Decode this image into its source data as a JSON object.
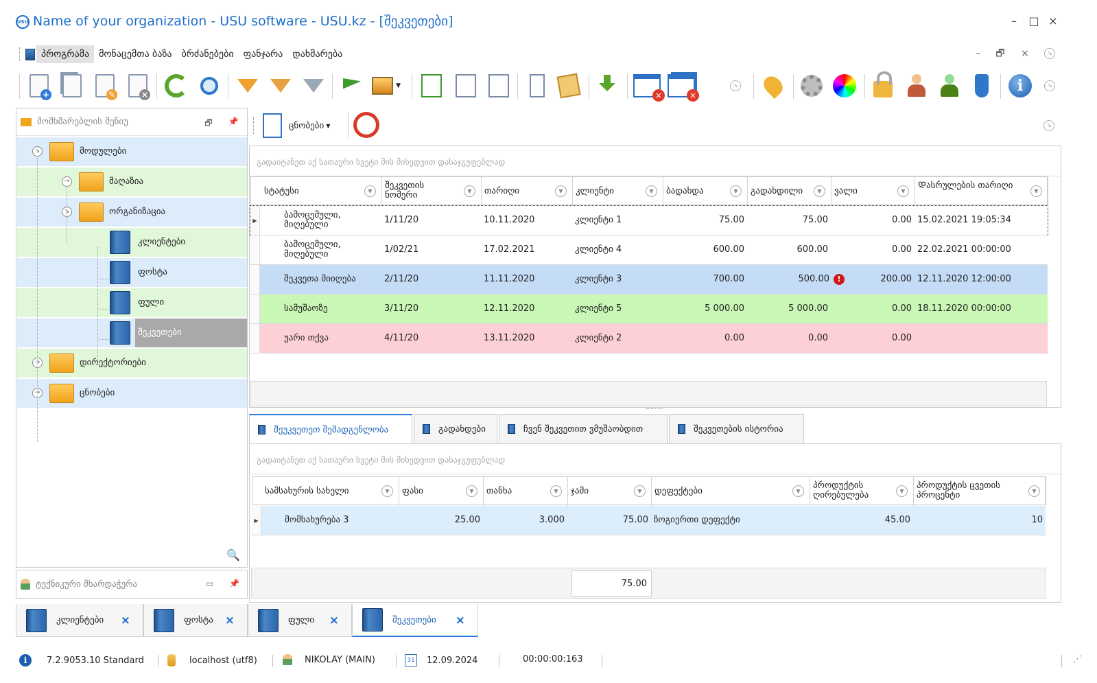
{
  "window": {
    "logo_text": "USU",
    "title": "Name of your organization - USU software - USU.kz - [შეკვეთები]",
    "minimize": "–",
    "maximize": "□",
    "close": "×"
  },
  "menu": {
    "items": [
      "პროგრამა",
      "მონაცემთა ბაზა",
      "ბრძანებები",
      "ფანჯარა",
      "დახმარება"
    ],
    "active_index": 0
  },
  "toolbar": {
    "icons": [
      "add-icon",
      "copy-icon",
      "edit-icon",
      "delete-icon",
      "refresh-icon",
      "search-icon",
      "filter-icon",
      "filter-settings-icon",
      "filter-clear-icon",
      "flag-icon",
      "image-icon",
      "expand-all-icon",
      "tree-collapse-icon",
      "tree-expand-icon",
      "add-column-icon",
      "notes-icon",
      "download-icon",
      "close-window-icon",
      "close-all-windows-icon",
      "location-pin-icon",
      "settings-gear-icon",
      "color-wheel-icon",
      "lock-icon",
      "user-keys-icon",
      "users-icon",
      "plug-icon",
      "info-icon"
    ]
  },
  "left_panel": {
    "title": "მომხმარებლის მენიუ",
    "tree": [
      {
        "label": "მოდულები",
        "level": 0,
        "expanded": true,
        "type": "folder"
      },
      {
        "label": "მაღაზია",
        "level": 1,
        "expanded": false,
        "type": "folder"
      },
      {
        "label": "ორგანიზაცია",
        "level": 1,
        "expanded": true,
        "type": "folder"
      },
      {
        "label": "კლიენტები",
        "level": 2,
        "type": "book"
      },
      {
        "label": "ფოსტა",
        "level": 2,
        "type": "book"
      },
      {
        "label": "ფული",
        "level": 2,
        "type": "book"
      },
      {
        "label": "შეკვეთები",
        "level": 2,
        "type": "book",
        "selected": true
      },
      {
        "label": "დირექტორიები",
        "level": 0,
        "expanded": false,
        "type": "folder"
      },
      {
        "label": "ცნობები",
        "level": 0,
        "expanded": false,
        "type": "folder"
      }
    ],
    "search_icon": "search-icon"
  },
  "support_panel": {
    "title": "ტექნიკური მხარდაჭერა"
  },
  "reports_toolbar": {
    "reports_label": "ცნობები"
  },
  "orders_grid": {
    "group_hint": "გადაიტანეთ აქ სათაური სვეტი მის მიხედვით დასაჯგუფებლად",
    "columns": [
      "სტატუსი",
      "შეკვეთის ნომერი",
      "თარიღი",
      "კლიენტი",
      "ბადახდა",
      "გადახდილი",
      "ვალი",
      "Დასრულების თარიღი"
    ],
    "rows": [
      {
        "status": "ბამოცემული, მიღებული",
        "number": "1/11/20",
        "date": "10.11.2020",
        "client": "კლიენტი 1",
        "paid_due": "75.00",
        "paid": "75.00",
        "debt": "0.00",
        "completed": "15.02.2021 19:05:34",
        "color": "#ffffff",
        "alert": false,
        "current": true
      },
      {
        "status": "ბამოცემული, მიღებული",
        "number": "1/02/21",
        "date": "17.02.2021",
        "client": "კლიენტი 4",
        "paid_due": "600.00",
        "paid": "600.00",
        "debt": "0.00",
        "completed": "22.02.2021 00:00:00",
        "color": "#ffffff",
        "alert": false,
        "current": false
      },
      {
        "status": "შეკვეთა მიიღება",
        "number": "2/11/20",
        "date": "11.11.2020",
        "client": "კლიენტი 3",
        "paid_due": "700.00",
        "paid": "500.00",
        "debt": "200.00",
        "completed": "12.11.2020 12:00:00",
        "color": "#c5dcf6",
        "alert": true,
        "current": false
      },
      {
        "status": "სამუშაოზე",
        "number": "3/11/20",
        "date": "12.11.2020",
        "client": "კლიენტი 5",
        "paid_due": "5 000.00",
        "paid": "5 000.00",
        "debt": "0.00",
        "completed": "18.11.2020 00:00:00",
        "color": "#c9f7b5",
        "alert": false,
        "current": false
      },
      {
        "status": "უარი თქვა",
        "number": "4/11/20",
        "date": "13.11.2020",
        "client": "კლიენტი 2",
        "paid_due": "0.00",
        "paid": "0.00",
        "debt": "0.00",
        "completed": "",
        "color": "#fcd0d4",
        "alert": false,
        "current": false
      }
    ]
  },
  "detail_tabs": {
    "tabs": [
      "შეუკვეთეთ შემადგენლობა",
      "გადახდები",
      "ჩვენ შეკვეთით ვმუშაობდით",
      "შეკვეთების ისტორია"
    ],
    "active_index": 0
  },
  "detail_grid": {
    "group_hint": "გადაიტანეთ აქ სათაური სვეტი მის მიხედვით დასაჯგუფებლად",
    "columns": [
      "სამსახურის სახელი",
      "ფასი",
      "თანხა",
      "ჯამი",
      "დეფექტები",
      "პროდუქტის ღირებულება",
      "პროდუქტის ცვეთის პროცენტი"
    ],
    "rows": [
      {
        "service": "მომსახურება 3",
        "price": "25.00",
        "qty": "3.000",
        "sum": "75.00",
        "defects": "ზოგიერთი დეფექტი",
        "product_value": "45.00",
        "wear_percent": "10"
      }
    ],
    "total": "75.00"
  },
  "doc_tabs": {
    "tabs": [
      "კლიენტები",
      "ფოსტა",
      "ფული",
      "შეკვეთები"
    ],
    "active_index": 3,
    "close_glyph": "×"
  },
  "status_bar": {
    "version": "7.2.9053.10 Standard",
    "database": "localhost (utf8)",
    "user": "NIKOLAY (MAIN)",
    "calendar_day": "31",
    "date": "12.09.2024",
    "timer": "00:00:00:163"
  },
  "colors": {
    "accent": "#1c6fc9",
    "tree_row_blue": "#dcecfb",
    "tree_row_green": "#e1f7d9",
    "tree_selected": "#a9a9a9",
    "row_blue": "#c5dcf6",
    "row_green": "#c9f7b5",
    "row_red": "#fcd0d4",
    "detail_row": "#dcedfb"
  }
}
